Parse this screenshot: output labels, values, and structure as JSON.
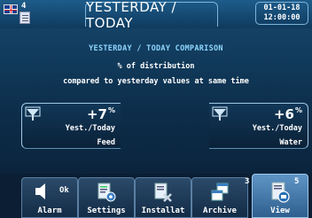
{
  "header": {
    "title": "YESTERDAY / TODAY",
    "indicator_number": "4",
    "date": "01-01-18",
    "time": "12:00:00"
  },
  "main": {
    "heading": "YESTERDAY / TODAY COMPARISON",
    "subheading": "% of distribution",
    "description": "compared to yesterday values at same time"
  },
  "cards": [
    {
      "value": "+7",
      "unit": "%",
      "label": "Yest./Today",
      "category": "Feed",
      "icon": "funnel-icon"
    },
    {
      "value": "+6",
      "unit": "%",
      "label": "Yest./Today",
      "category": "Water",
      "icon": "funnel-icon"
    }
  ],
  "nav": {
    "items": [
      {
        "label": "Alarm",
        "badge": "Ok",
        "icon": "speaker-icon"
      },
      {
        "label": "Settings",
        "icon": "settings-document-icon"
      },
      {
        "label": "Installat",
        "icon": "installation-document-icon"
      },
      {
        "label": "Archive",
        "icon": "archive-windows-icon"
      },
      {
        "label": "View",
        "icon": "view-document-icon",
        "active": true
      }
    ],
    "page_left": "3",
    "page_right": "5"
  },
  "colors": {
    "background": "#0c2c48",
    "heading": "#8ed6ff",
    "text": "#ffffff",
    "active_tab": "#5f95c6"
  }
}
